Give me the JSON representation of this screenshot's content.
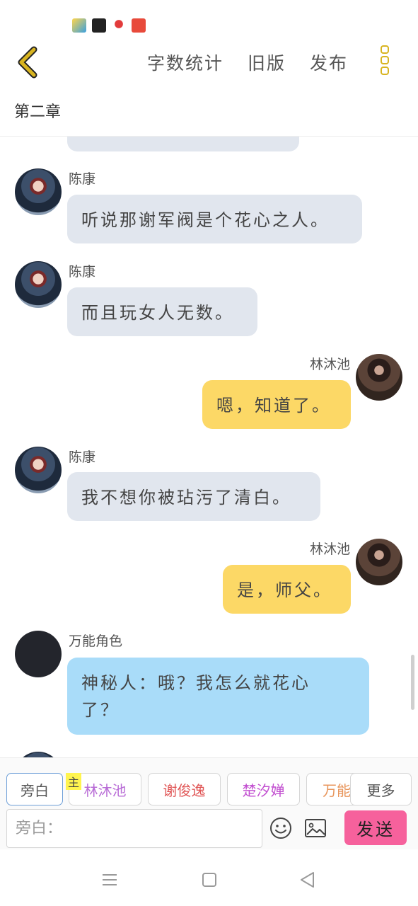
{
  "topbar": {
    "word_count": "字数统计",
    "old_version": "旧版",
    "publish": "发布",
    "accent_color": "#d8b420"
  },
  "chapter": {
    "title": "第二章"
  },
  "messages": [
    {
      "side": "left",
      "sender": "陈康",
      "text": "听说那谢军阀是个花心之人。"
    },
    {
      "side": "left",
      "sender": "陈康",
      "text": "而且玩女人无数。"
    },
    {
      "side": "right",
      "sender": "林沐池",
      "text": "嗯，知道了。"
    },
    {
      "side": "left",
      "sender": "陈康",
      "text": "我不想你被玷污了清白。"
    },
    {
      "side": "right",
      "sender": "林沐池",
      "text": "是，师父。"
    },
    {
      "side": "left",
      "sender": "万能角色",
      "text": "神秘人：哦？我怎么就花心了？"
    }
  ],
  "roles": {
    "narration": "旁白",
    "main_tag": "主",
    "lin": "林沐池",
    "xie": "谢俊逸",
    "chu": "楚汐婵",
    "wan": "万能",
    "more": "更多"
  },
  "input": {
    "placeholder": "旁白：",
    "value": ""
  },
  "send": {
    "label": "发送",
    "color": "#f6619c"
  },
  "colors": {
    "bubble_other": "#e1e6ee",
    "bubble_self": "#fcd866",
    "bubble_wildcard": "#a9dcf9"
  }
}
